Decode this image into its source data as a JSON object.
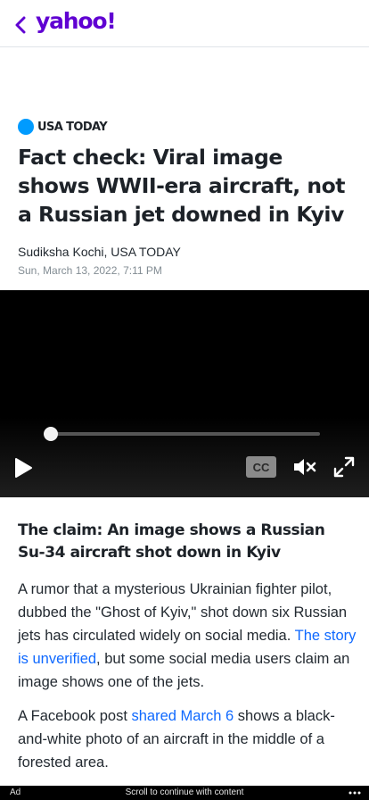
{
  "header": {
    "logo": "yahoo!"
  },
  "article": {
    "source": "USA TODAY",
    "headline": "Fact check: Viral image shows WWII-era aircraft, not a Russian jet downed in Kyiv",
    "byline": "Sudiksha Kochi, USA TODAY",
    "date": "Sun, March 13, 2022, 7:11 PM",
    "video": {
      "cc_label": "CC",
      "progress": 0
    },
    "claim_heading": "The claim: An image shows a Russian Su-34 aircraft shot down in Kyiv",
    "p1": {
      "text_before": "A rumor that a mysterious Ukrainian fighter pilot, dubbed the \"Ghost of Kyiv,\" shot down six Russian jets has circulated widely on social media. ",
      "link": "The story is unverified",
      "text_after": ", but some social media users claim an image shows one of the jets."
    },
    "p2": {
      "text_before": "A Facebook post ",
      "link": "shared March 6",
      "text_after": " shows a black-and-white photo of an aircraft in the middle of a forested area."
    }
  },
  "ad_bar": {
    "ad_label": "Ad",
    "scroll_message": "Scroll to continue with content"
  },
  "colors": {
    "brand": "#6001d2",
    "link": "#0f69ff",
    "source_dot": "#009bff"
  }
}
